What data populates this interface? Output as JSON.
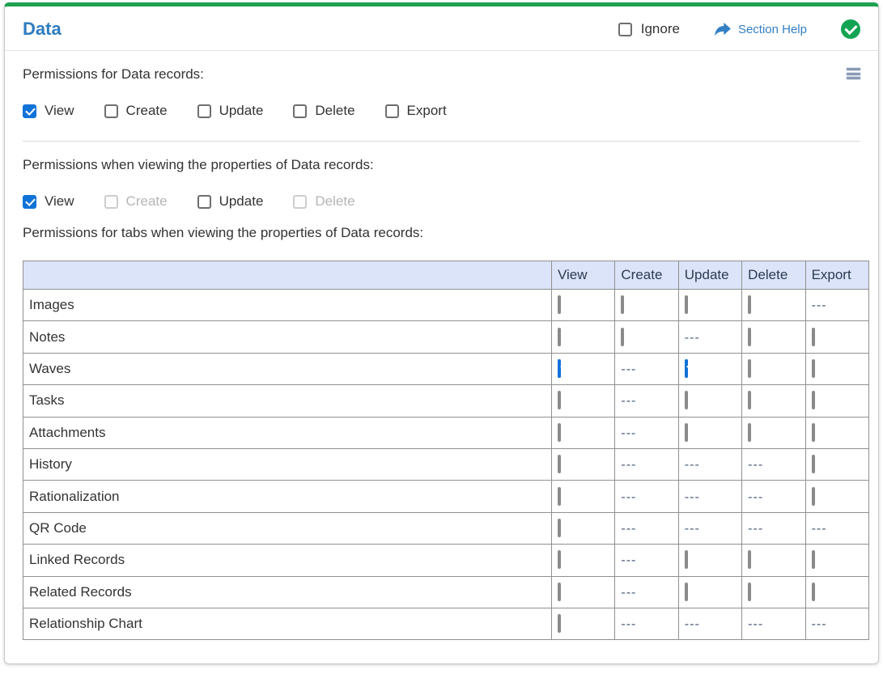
{
  "header": {
    "title": "Data",
    "ignore_label": "Ignore",
    "section_help_label": "Section Help"
  },
  "sections": {
    "records": {
      "label": "Permissions for Data records:",
      "checkboxes": [
        {
          "label": "View",
          "checked": true,
          "disabled": false
        },
        {
          "label": "Create",
          "checked": false,
          "disabled": false
        },
        {
          "label": "Update",
          "checked": false,
          "disabled": false
        },
        {
          "label": "Delete",
          "checked": false,
          "disabled": false
        },
        {
          "label": "Export",
          "checked": false,
          "disabled": false
        }
      ]
    },
    "properties": {
      "label": "Permissions when viewing the properties of Data records:",
      "checkboxes": [
        {
          "label": "View",
          "checked": true,
          "disabled": false
        },
        {
          "label": "Create",
          "checked": false,
          "disabled": true
        },
        {
          "label": "Update",
          "checked": false,
          "disabled": false
        },
        {
          "label": "Delete",
          "checked": false,
          "disabled": true
        }
      ]
    },
    "tabs": {
      "label": "Permissions for tabs when viewing the properties of Data records:",
      "table": {
        "columns": [
          "View",
          "Create",
          "Update",
          "Delete",
          "Export"
        ],
        "na_text": "---",
        "rows": [
          {
            "label": "Images",
            "cells": [
              "unchecked",
              "unchecked",
              "unchecked",
              "unchecked",
              "na"
            ]
          },
          {
            "label": "Notes",
            "cells": [
              "unchecked",
              "unchecked",
              "na",
              "unchecked",
              "unchecked"
            ]
          },
          {
            "label": "Waves",
            "cells": [
              "checked",
              "na",
              "checked",
              "unchecked",
              "unchecked"
            ]
          },
          {
            "label": "Tasks",
            "cells": [
              "unchecked",
              "na",
              "unchecked",
              "unchecked",
              "unchecked"
            ]
          },
          {
            "label": "Attachments",
            "cells": [
              "unchecked",
              "na",
              "unchecked",
              "unchecked",
              "unchecked"
            ]
          },
          {
            "label": "History",
            "cells": [
              "unchecked",
              "na",
              "na",
              "na",
              "unchecked"
            ]
          },
          {
            "label": "Rationalization",
            "cells": [
              "unchecked",
              "na",
              "na",
              "na",
              "unchecked"
            ]
          },
          {
            "label": "QR Code",
            "cells": [
              "unchecked",
              "na",
              "na",
              "na",
              "na"
            ]
          },
          {
            "label": "Linked Records",
            "cells": [
              "unchecked",
              "na",
              "unchecked",
              "unchecked",
              "unchecked"
            ]
          },
          {
            "label": "Related Records",
            "cells": [
              "unchecked",
              "na",
              "unchecked",
              "unchecked",
              "unchecked"
            ]
          },
          {
            "label": "Relationship Chart",
            "cells": [
              "unchecked",
              "na",
              "na",
              "na",
              "na"
            ]
          }
        ]
      }
    }
  },
  "colors": {
    "card_top_accent": "#1ea150",
    "title_blue": "#2e7cbf",
    "link_blue": "#3380c4",
    "checkbox_blue": "#1172d8",
    "status_green": "#13a453",
    "table_header_bg": "#dbe4f8",
    "checked_cell_bg": "#d4f9e3",
    "table_border": "#909090"
  }
}
